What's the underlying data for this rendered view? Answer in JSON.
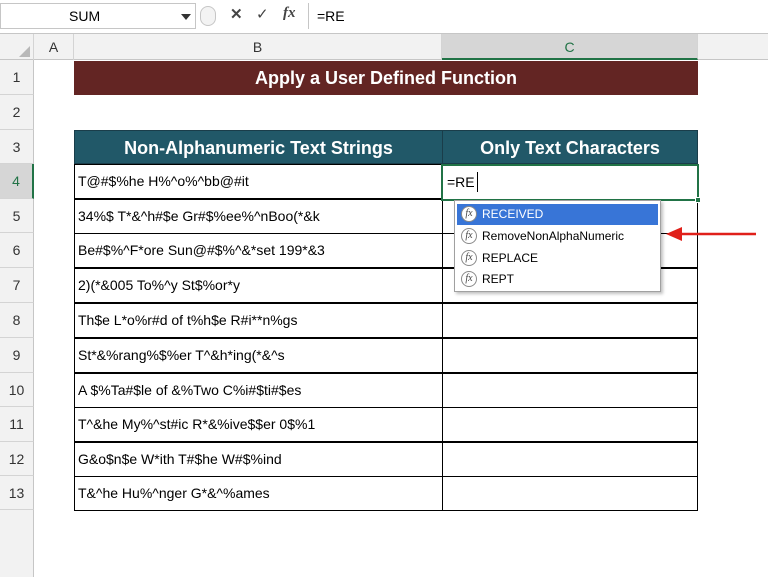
{
  "formula_bar": {
    "name_box": "SUM",
    "cancel_symbol": "✕",
    "enter_symbol": "✓",
    "fx_symbol": "fx",
    "formula": "=RE"
  },
  "columns": [
    "A",
    "B",
    "C"
  ],
  "rows": [
    "1",
    "2",
    "3",
    "4",
    "5",
    "6",
    "7",
    "8",
    "9",
    "10",
    "11",
    "12",
    "13"
  ],
  "banner": {
    "title": "Apply a User Defined Function"
  },
  "table": {
    "headers": [
      "Non-Alphanumeric Text Strings",
      "Only Text Characters"
    ],
    "strings": [
      "T@#$%he H%^o%^bb@#it",
      "34%$ T*&^h#$e Gr#$%ee%^nBoo(*&k",
      "Be#$%^F*ore Sun@#$%^&*set 199*&3",
      "2)(*&005 To%^y St$%or*y",
      "Th$e L*o%r#d of t%h$e R#i**n%gs",
      "St*&%rang%$%er T^&h*ing(*&^s",
      "A $%Ta#$le of &%Two C%i#$ti#$es",
      "T^&he My%^st#ic R*&%ive$$er 0$%1",
      "G&o$n$e W*ith T#$he W#$%ind",
      "T&^he Hu%^nger G*&^%ames"
    ],
    "active_cell_text": "=RE"
  },
  "autocomplete": {
    "icon_symbol": "fx",
    "items": [
      "RECEIVED",
      "RemoveNonAlphaNumeric",
      "REPLACE",
      "REPT"
    ],
    "selected_index": 0
  },
  "colors": {
    "banner": "#632523",
    "table_header": "#215868",
    "selection_green": "#217346",
    "highlight_blue": "#3875d7",
    "arrow_red": "#e0201a"
  }
}
